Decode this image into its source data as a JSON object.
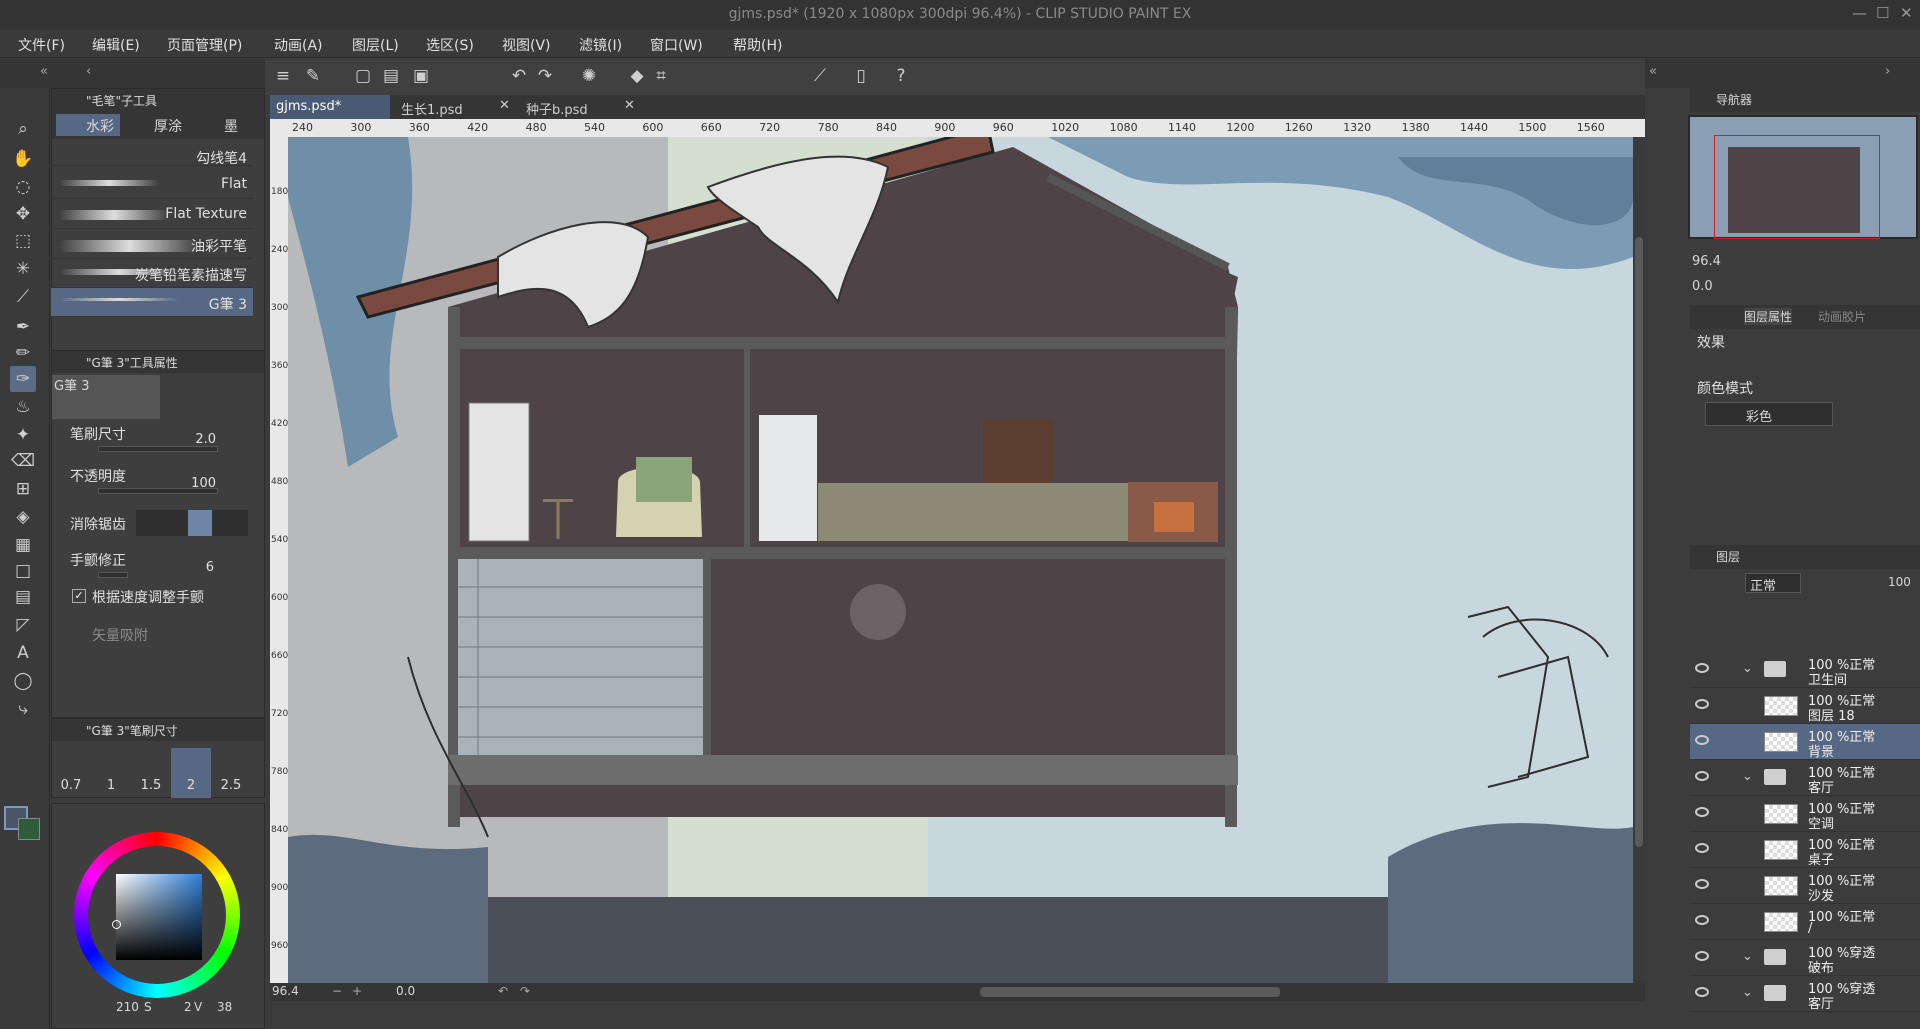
{
  "window": {
    "title": "gjms.psd* (1920 x 1080px 300dpi 96.4%) - CLIP STUDIO PAINT EX"
  },
  "menu": [
    "文件(F)",
    "编辑(E)",
    "页面管理(P)",
    "动画(A)",
    "图层(L)",
    "选区(S)",
    "视图(V)",
    "滤镜(I)",
    "窗口(W)",
    "帮助(H)"
  ],
  "subtool": {
    "header": "\"毛笔\"子工具",
    "tabs": [
      "水彩",
      "厚涂",
      "墨"
    ],
    "brushes": [
      "勾线笔4",
      "Flat",
      "Flat Texture",
      "油彩平笔",
      "炭笔铅笔素描速写",
      "G筆 3"
    ]
  },
  "toolprops": {
    "header": "\"G筆 3\"工具属性",
    "preview_label": "G筆 3",
    "size_label": "笔刷尺寸",
    "size_value": "2.0",
    "opacity_label": "不透明度",
    "opacity_value": "100",
    "antialias_label": "消除锯齿",
    "stab_label": "手颤修正",
    "stab_value": "6",
    "speed_label": "根据速度调整手颤",
    "vector_label": "矢量吸附"
  },
  "brushsize": {
    "header": "\"G筆 3\"笔刷尺寸",
    "sizes": [
      "0.7",
      "1",
      "1.5",
      "2",
      "2.5"
    ],
    "selected": "2"
  },
  "color": {
    "hsv_readout": "210",
    "s_label": "S",
    "v_readout": "2",
    "v_label": "V",
    "extra": "38"
  },
  "tabs": [
    {
      "label": "gjms.psd*"
    },
    {
      "label": "生长1.psd"
    },
    {
      "label": "种子b.psd"
    }
  ],
  "ruler_h": [
    "240",
    "300",
    "360",
    "420",
    "480",
    "540",
    "600",
    "660",
    "720",
    "780",
    "840",
    "900",
    "960",
    "1020",
    "1080",
    "1140",
    "1200",
    "1260",
    "1320",
    "1380",
    "1440",
    "1500",
    "1560"
  ],
  "ruler_v": [
    "180",
    "240",
    "300",
    "360",
    "420",
    "480",
    "540",
    "600",
    "660",
    "720",
    "780",
    "840",
    "900",
    "960"
  ],
  "status": {
    "zoom": "96.4",
    "angle": "0.0"
  },
  "navigator": {
    "title": "导航器",
    "zoom": "96.4",
    "angle": "0.0"
  },
  "layerprops": {
    "title": "图层属性",
    "anim_tab": "动画胶片",
    "effect_label": "效果",
    "colormode_label": "颜色模式",
    "colormode_value": "彩色"
  },
  "layers": {
    "title": "图层",
    "blend": "正常",
    "opacity": "100",
    "items": [
      {
        "pct": "100 %正常",
        "name": "卫生间",
        "type": "folder"
      },
      {
        "pct": "100 %正常",
        "name": "图层 18",
        "type": "layer"
      },
      {
        "pct": "100 %正常",
        "name": "背景",
        "type": "layer",
        "selected": true
      },
      {
        "pct": "100 %正常",
        "name": "客厅",
        "type": "folder"
      },
      {
        "pct": "100 %正常",
        "name": "空调",
        "type": "layer"
      },
      {
        "pct": "100 %正常",
        "name": "桌子",
        "type": "layer"
      },
      {
        "pct": "100 %正常",
        "name": "沙发",
        "type": "layer"
      },
      {
        "pct": "100 %正常",
        "name": "/",
        "type": "layer"
      },
      {
        "pct": "100 %穿透",
        "name": "破布",
        "type": "folder"
      },
      {
        "pct": "100 %穿透",
        "name": "客厅",
        "type": "folder"
      }
    ]
  },
  "colors": {
    "accent": "#566883",
    "canvas_sky": "#c9d6dc",
    "wall": "#4e4448",
    "roof": "#7a4a40"
  }
}
